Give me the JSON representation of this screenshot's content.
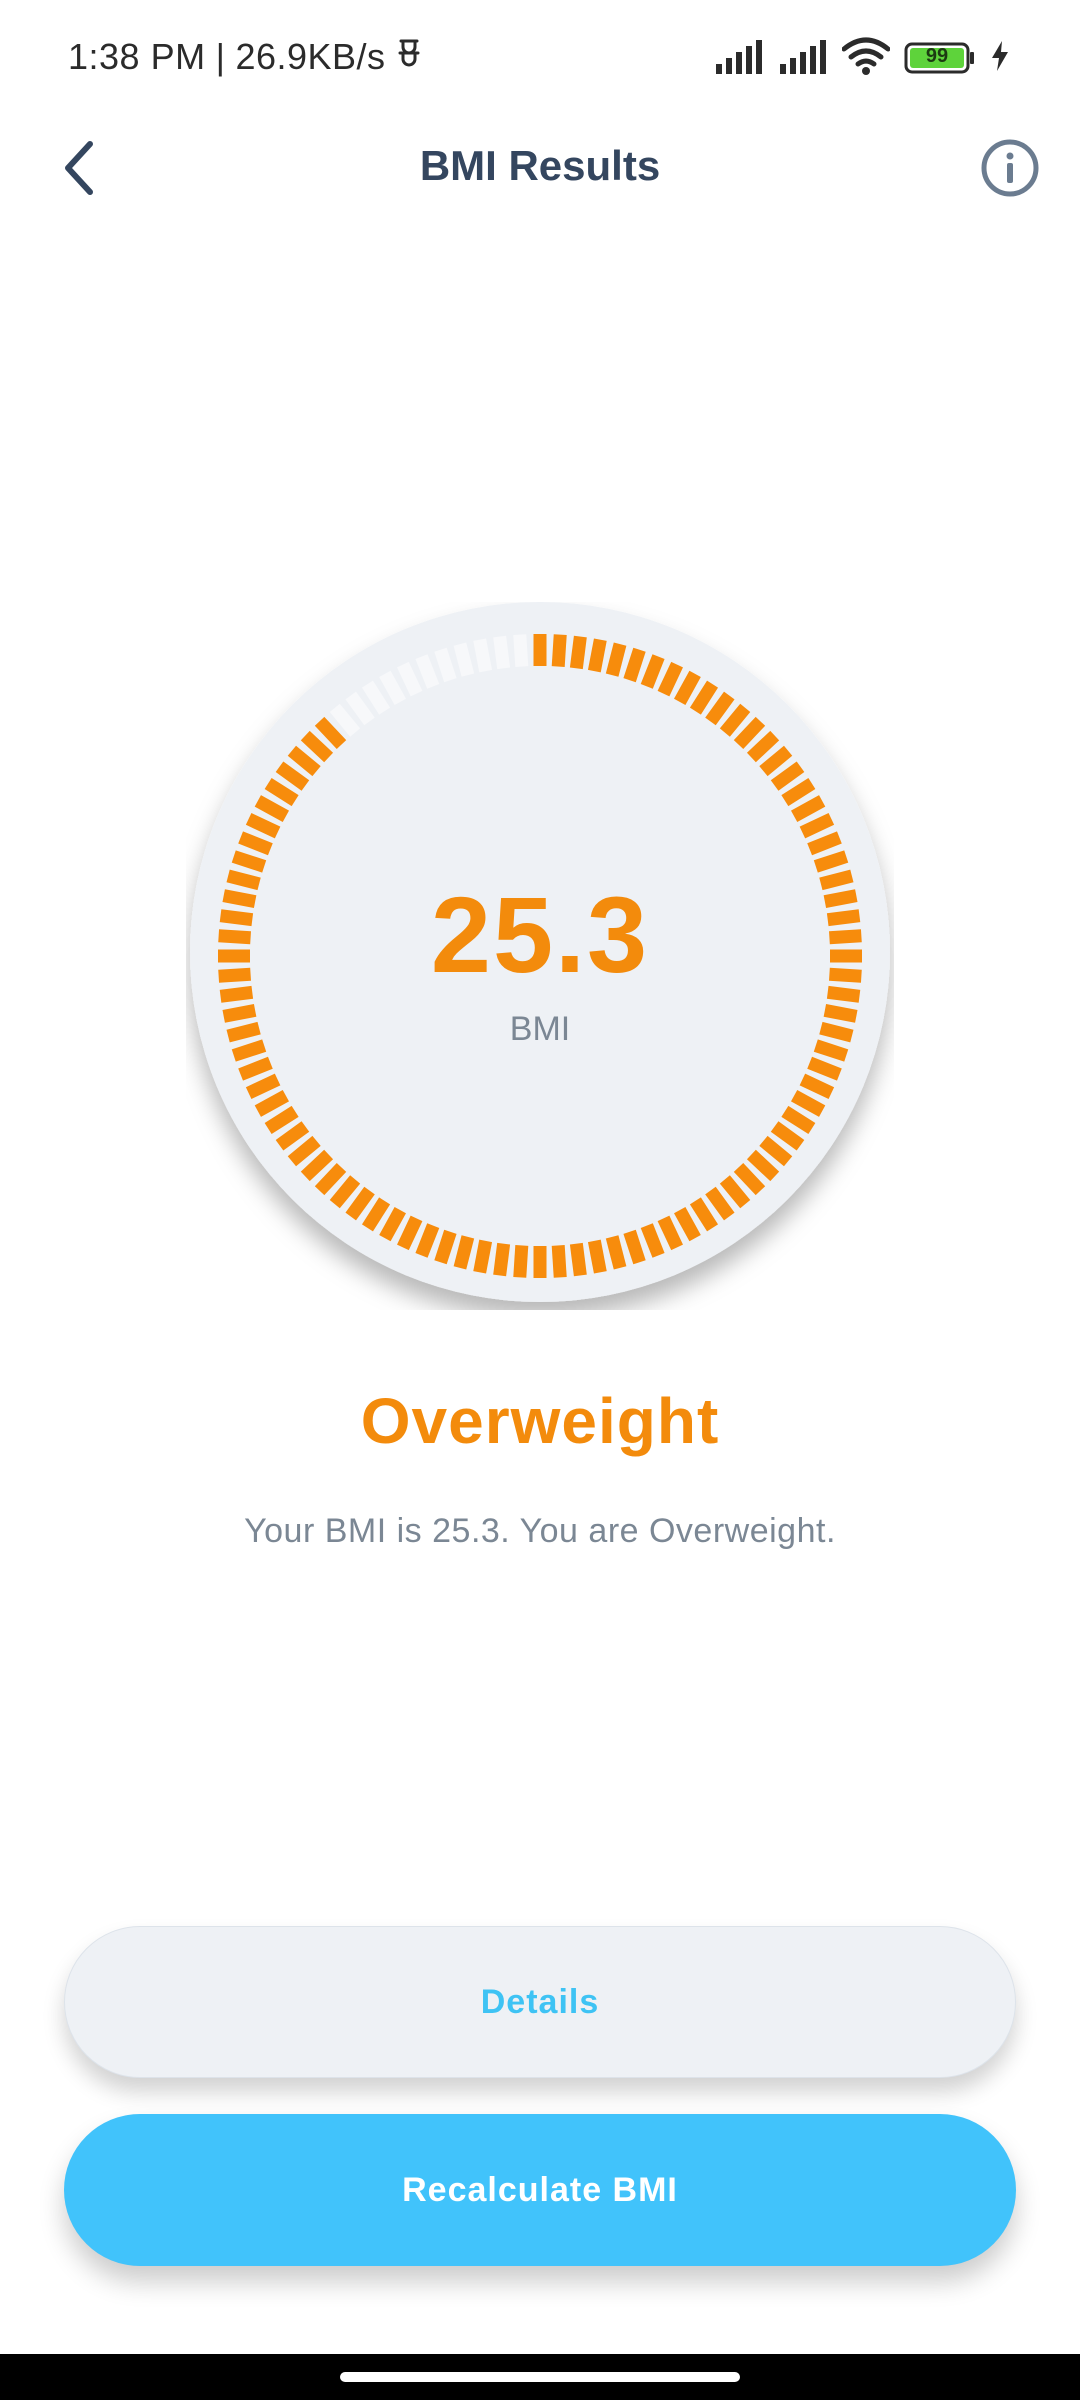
{
  "status_bar": {
    "time": "1:38 PM",
    "separator": "|",
    "network_speed": "26.9KB/s",
    "battery_level": "99",
    "icons": [
      "notification-icon",
      "signal-icon",
      "signal-icon",
      "wifi-icon",
      "battery-icon",
      "charging-icon"
    ]
  },
  "app_bar": {
    "title": "BMI Results",
    "back_icon": "chevron-left-icon",
    "info_icon": "info-icon"
  },
  "gauge": {
    "value": "25.3",
    "label": "BMI",
    "fill_fraction": 0.89,
    "segment_count": 100,
    "active_color": "#f78c0c",
    "inactive_color": "#f7f8fa",
    "face_color": "#eef1f5"
  },
  "result": {
    "category": "Overweight",
    "description": "Your BMI is 25.3. You are Overweight.",
    "accent_color": "#f38b0c"
  },
  "buttons": {
    "details_label": "Details",
    "recalculate_label": "Recalculate BMI",
    "primary_color": "#41c3fb"
  }
}
